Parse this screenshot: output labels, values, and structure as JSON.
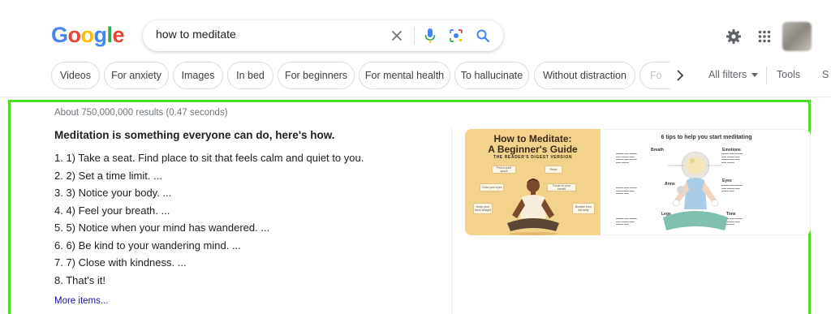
{
  "header": {
    "logo_letters": [
      "G",
      "o",
      "o",
      "g",
      "l",
      "e"
    ],
    "search_value": "how to meditate"
  },
  "icons": {
    "clear": "close-icon",
    "voice": "microphone-icon",
    "lens": "camera-lens-icon",
    "search": "search-icon",
    "settings": "gear-icon",
    "apps": "apps-grid-icon",
    "chevron": "chevron-right-icon"
  },
  "chips": [
    "Videos",
    "For anxiety",
    "Images",
    "In bed",
    "For beginners",
    "For mental health",
    "To hallucinate",
    "Without distraction",
    "Fo"
  ],
  "filters": {
    "all_filters": "All filters",
    "tools": "Tools",
    "tools_cut": "S"
  },
  "results": {
    "stats": "About 750,000,000 results (0.47 seconds)",
    "answer_title": "Meditation is something everyone can do, here's how.",
    "steps": [
      "1. 1) Take a seat. Find place to sit that feels calm and quiet to you.",
      "2. 2) Set a time limit. ...",
      "3. 3) Notice your body. ...",
      "4. 4) Feel your breath. ...",
      "5. 5) Notice when your mind has wandered. ...",
      "6. 6) Be kind to your wandering mind. ...",
      "7. 7) Close with kindness. ...",
      "8. That's it!"
    ],
    "more_items": "More items..."
  },
  "images": {
    "guide": {
      "title_line1": "How to Meditate:",
      "title_line2": "A Beginner's Guide",
      "subtitle": "THE READER'S DIGEST VERSION",
      "tips": [
        "Find a quiet space",
        "Relax",
        "Close your eyes",
        "Focus on your breath",
        "Keep your back straight",
        "Breathe from the belly"
      ]
    },
    "tips": {
      "title": "6 tips to help you start meditating",
      "labels": [
        "Breath",
        "Emotions",
        "Arms",
        "Eyes",
        "Legs",
        "Time"
      ]
    }
  },
  "colors": {
    "highlight_frame": "#4cdd2c",
    "link": "#1a0dab",
    "guide_bg": "#f3d38c"
  }
}
